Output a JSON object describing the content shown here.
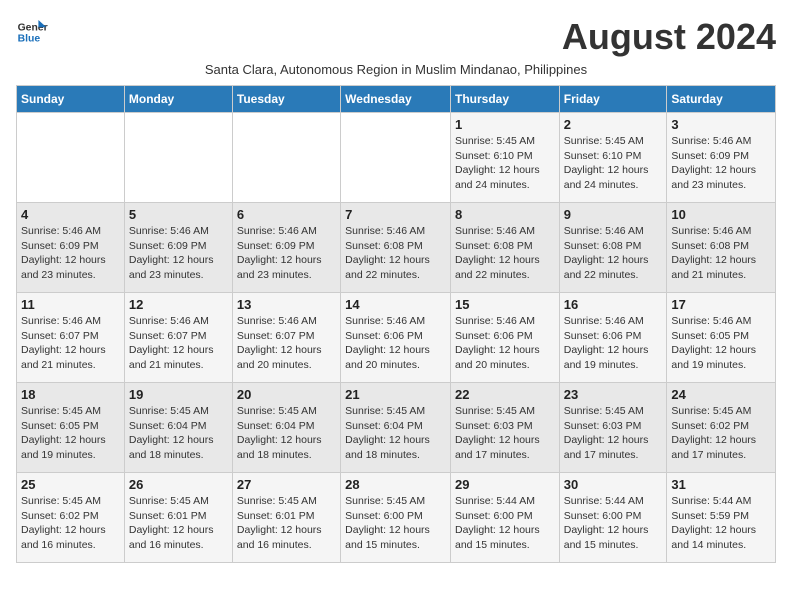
{
  "title": "August 2024",
  "subtitle": "Santa Clara, Autonomous Region in Muslim Mindanao, Philippines",
  "logo": {
    "line1": "General",
    "line2": "Blue"
  },
  "days_of_week": [
    "Sunday",
    "Monday",
    "Tuesday",
    "Wednesday",
    "Thursday",
    "Friday",
    "Saturday"
  ],
  "weeks": [
    [
      {
        "num": "",
        "detail": ""
      },
      {
        "num": "",
        "detail": ""
      },
      {
        "num": "",
        "detail": ""
      },
      {
        "num": "",
        "detail": ""
      },
      {
        "num": "1",
        "detail": "Sunrise: 5:45 AM\nSunset: 6:10 PM\nDaylight: 12 hours\nand 24 minutes."
      },
      {
        "num": "2",
        "detail": "Sunrise: 5:45 AM\nSunset: 6:10 PM\nDaylight: 12 hours\nand 24 minutes."
      },
      {
        "num": "3",
        "detail": "Sunrise: 5:46 AM\nSunset: 6:09 PM\nDaylight: 12 hours\nand 23 minutes."
      }
    ],
    [
      {
        "num": "4",
        "detail": "Sunrise: 5:46 AM\nSunset: 6:09 PM\nDaylight: 12 hours\nand 23 minutes."
      },
      {
        "num": "5",
        "detail": "Sunrise: 5:46 AM\nSunset: 6:09 PM\nDaylight: 12 hours\nand 23 minutes."
      },
      {
        "num": "6",
        "detail": "Sunrise: 5:46 AM\nSunset: 6:09 PM\nDaylight: 12 hours\nand 23 minutes."
      },
      {
        "num": "7",
        "detail": "Sunrise: 5:46 AM\nSunset: 6:08 PM\nDaylight: 12 hours\nand 22 minutes."
      },
      {
        "num": "8",
        "detail": "Sunrise: 5:46 AM\nSunset: 6:08 PM\nDaylight: 12 hours\nand 22 minutes."
      },
      {
        "num": "9",
        "detail": "Sunrise: 5:46 AM\nSunset: 6:08 PM\nDaylight: 12 hours\nand 22 minutes."
      },
      {
        "num": "10",
        "detail": "Sunrise: 5:46 AM\nSunset: 6:08 PM\nDaylight: 12 hours\nand 21 minutes."
      }
    ],
    [
      {
        "num": "11",
        "detail": "Sunrise: 5:46 AM\nSunset: 6:07 PM\nDaylight: 12 hours\nand 21 minutes."
      },
      {
        "num": "12",
        "detail": "Sunrise: 5:46 AM\nSunset: 6:07 PM\nDaylight: 12 hours\nand 21 minutes."
      },
      {
        "num": "13",
        "detail": "Sunrise: 5:46 AM\nSunset: 6:07 PM\nDaylight: 12 hours\nand 20 minutes."
      },
      {
        "num": "14",
        "detail": "Sunrise: 5:46 AM\nSunset: 6:06 PM\nDaylight: 12 hours\nand 20 minutes."
      },
      {
        "num": "15",
        "detail": "Sunrise: 5:46 AM\nSunset: 6:06 PM\nDaylight: 12 hours\nand 20 minutes."
      },
      {
        "num": "16",
        "detail": "Sunrise: 5:46 AM\nSunset: 6:06 PM\nDaylight: 12 hours\nand 19 minutes."
      },
      {
        "num": "17",
        "detail": "Sunrise: 5:46 AM\nSunset: 6:05 PM\nDaylight: 12 hours\nand 19 minutes."
      }
    ],
    [
      {
        "num": "18",
        "detail": "Sunrise: 5:45 AM\nSunset: 6:05 PM\nDaylight: 12 hours\nand 19 minutes."
      },
      {
        "num": "19",
        "detail": "Sunrise: 5:45 AM\nSunset: 6:04 PM\nDaylight: 12 hours\nand 18 minutes."
      },
      {
        "num": "20",
        "detail": "Sunrise: 5:45 AM\nSunset: 6:04 PM\nDaylight: 12 hours\nand 18 minutes."
      },
      {
        "num": "21",
        "detail": "Sunrise: 5:45 AM\nSunset: 6:04 PM\nDaylight: 12 hours\nand 18 minutes."
      },
      {
        "num": "22",
        "detail": "Sunrise: 5:45 AM\nSunset: 6:03 PM\nDaylight: 12 hours\nand 17 minutes."
      },
      {
        "num": "23",
        "detail": "Sunrise: 5:45 AM\nSunset: 6:03 PM\nDaylight: 12 hours\nand 17 minutes."
      },
      {
        "num": "24",
        "detail": "Sunrise: 5:45 AM\nSunset: 6:02 PM\nDaylight: 12 hours\nand 17 minutes."
      }
    ],
    [
      {
        "num": "25",
        "detail": "Sunrise: 5:45 AM\nSunset: 6:02 PM\nDaylight: 12 hours\nand 16 minutes."
      },
      {
        "num": "26",
        "detail": "Sunrise: 5:45 AM\nSunset: 6:01 PM\nDaylight: 12 hours\nand 16 minutes."
      },
      {
        "num": "27",
        "detail": "Sunrise: 5:45 AM\nSunset: 6:01 PM\nDaylight: 12 hours\nand 16 minutes."
      },
      {
        "num": "28",
        "detail": "Sunrise: 5:45 AM\nSunset: 6:00 PM\nDaylight: 12 hours\nand 15 minutes."
      },
      {
        "num": "29",
        "detail": "Sunrise: 5:44 AM\nSunset: 6:00 PM\nDaylight: 12 hours\nand 15 minutes."
      },
      {
        "num": "30",
        "detail": "Sunrise: 5:44 AM\nSunset: 6:00 PM\nDaylight: 12 hours\nand 15 minutes."
      },
      {
        "num": "31",
        "detail": "Sunrise: 5:44 AM\nSunset: 5:59 PM\nDaylight: 12 hours\nand 14 minutes."
      }
    ]
  ]
}
